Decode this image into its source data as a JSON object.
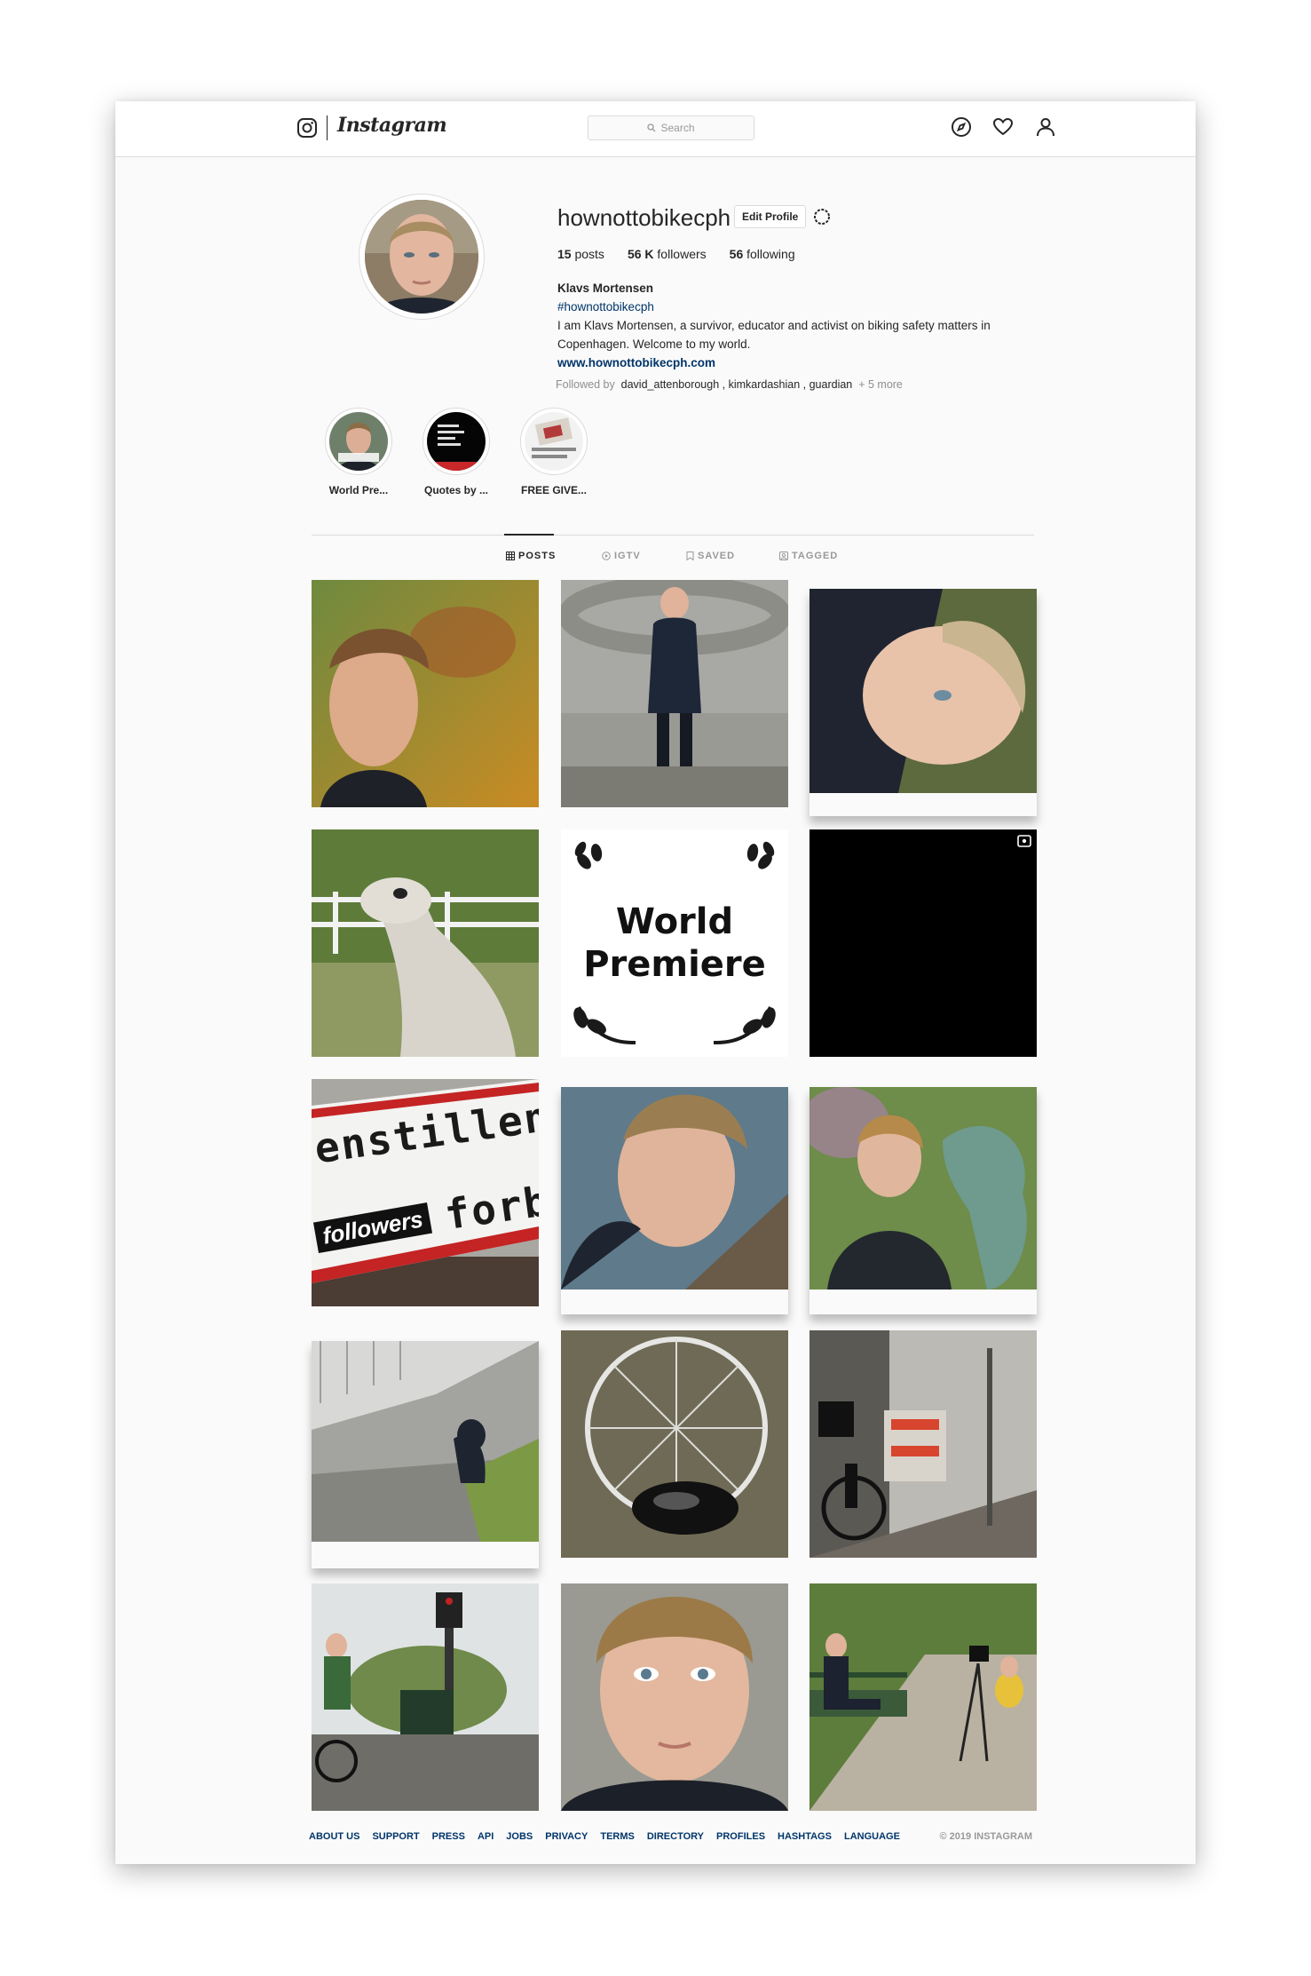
{
  "nav": {
    "brand": "Instagram",
    "search_placeholder": "Search"
  },
  "profile": {
    "username": "hownottobikecph",
    "edit_label": "Edit Profile",
    "stats": {
      "posts_count": "15",
      "posts_label": "posts",
      "followers_count": "56 K",
      "followers_label": "followers",
      "following_count": "56",
      "following_label": "following"
    },
    "full_name": "Klavs Mortensen",
    "hashtag": "#hownottobikecph",
    "bio_line1": "I am Klavs Mortensen, a survivor, educator and activist on biking safety matters in",
    "bio_line2": "Copenhagen. Welcome to my world.",
    "website": "www.hownottobikecph.com",
    "followed_by_label": "Followed by",
    "followed_by_users": "david_attenborough , kimkardashian , guardian",
    "followed_by_more": "+ 5 more"
  },
  "highlights": [
    {
      "label": "World Pre..."
    },
    {
      "label": "Quotes by ..."
    },
    {
      "label": "FREE GIVE..."
    }
  ],
  "tabs": [
    {
      "label": "POSTS",
      "active": true
    },
    {
      "label": "IGTV",
      "active": false
    },
    {
      "label": "SAVED",
      "active": false
    },
    {
      "label": "TAGGED",
      "active": false
    }
  ],
  "posts": {
    "world_premiere_line1": "World",
    "world_premiere_line2": "Premiere",
    "sign_text1": "enstillen",
    "sign_text2": "forb",
    "sign_sticker": "followers"
  },
  "footer": {
    "links": [
      "ABOUT US",
      "SUPPORT",
      "PRESS",
      "API",
      "JOBS",
      "PRIVACY",
      "TERMS",
      "DIRECTORY",
      "PROFILES",
      "HASHTAGS",
      "LANGUAGE"
    ],
    "copyright": "© 2019 INSTAGRAM"
  },
  "colors": {
    "link_blue": "#003569",
    "border": "#dbdbdb",
    "background": "#fafafa"
  }
}
